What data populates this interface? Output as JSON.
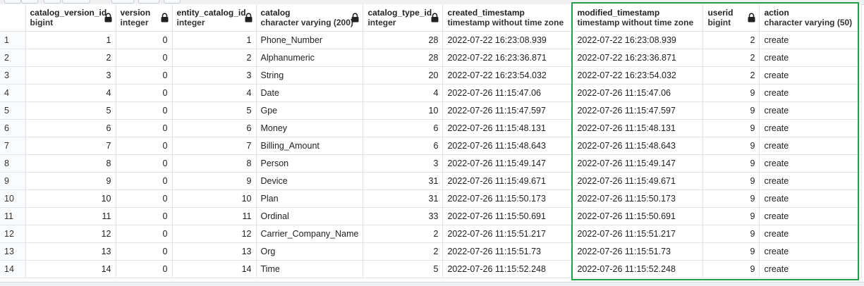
{
  "columns": [
    {
      "name": "catalog_version_id",
      "type": "bigint"
    },
    {
      "name": "version",
      "type": "integer"
    },
    {
      "name": "entity_catalog_id",
      "type": "integer"
    },
    {
      "name": "catalog",
      "type": "character varying (200)"
    },
    {
      "name": "catalog_type_id",
      "type": "integer"
    },
    {
      "name": "created_timestamp",
      "type": "timestamp without time zone"
    },
    {
      "name": "modified_timestamp",
      "type": "timestamp without time zone"
    },
    {
      "name": "userid",
      "type": "bigint"
    },
    {
      "name": "action",
      "type": "character varying (50)"
    }
  ],
  "rows": [
    {
      "rownum": "1",
      "cells": [
        "1",
        "0",
        "1",
        "Phone_Number",
        "28",
        "2022-07-22 16:23:08.939",
        "2022-07-22 16:23:08.939",
        "2",
        "create"
      ]
    },
    {
      "rownum": "2",
      "cells": [
        "2",
        "0",
        "2",
        "Alphanumeric",
        "28",
        "2022-07-22 16:23:36.871",
        "2022-07-22 16:23:36.871",
        "2",
        "create"
      ]
    },
    {
      "rownum": "3",
      "cells": [
        "3",
        "0",
        "3",
        "String",
        "20",
        "2022-07-22 16:23:54.032",
        "2022-07-22 16:23:54.032",
        "2",
        "create"
      ]
    },
    {
      "rownum": "4",
      "cells": [
        "4",
        "0",
        "4",
        "Date",
        "4",
        "2022-07-26 11:15:47.06",
        "2022-07-26 11:15:47.06",
        "9",
        "create"
      ]
    },
    {
      "rownum": "5",
      "cells": [
        "5",
        "0",
        "5",
        "Gpe",
        "10",
        "2022-07-26 11:15:47.597",
        "2022-07-26 11:15:47.597",
        "9",
        "create"
      ]
    },
    {
      "rownum": "6",
      "cells": [
        "6",
        "0",
        "6",
        "Money",
        "6",
        "2022-07-26 11:15:48.131",
        "2022-07-26 11:15:48.131",
        "9",
        "create"
      ]
    },
    {
      "rownum": "7",
      "cells": [
        "7",
        "0",
        "7",
        "Billing_Amount",
        "6",
        "2022-07-26 11:15:48.643",
        "2022-07-26 11:15:48.643",
        "9",
        "create"
      ]
    },
    {
      "rownum": "8",
      "cells": [
        "8",
        "0",
        "8",
        "Person",
        "3",
        "2022-07-26 11:15:49.147",
        "2022-07-26 11:15:49.147",
        "9",
        "create"
      ]
    },
    {
      "rownum": "9",
      "cells": [
        "9",
        "0",
        "9",
        "Device",
        "31",
        "2022-07-26 11:15:49.671",
        "2022-07-26 11:15:49.671",
        "9",
        "create"
      ]
    },
    {
      "rownum": "10",
      "cells": [
        "10",
        "0",
        "10",
        "Plan",
        "31",
        "2022-07-26 11:15:50.173",
        "2022-07-26 11:15:50.173",
        "9",
        "create"
      ]
    },
    {
      "rownum": "11",
      "cells": [
        "11",
        "0",
        "11",
        "Ordinal",
        "33",
        "2022-07-26 11:15:50.691",
        "2022-07-26 11:15:50.691",
        "9",
        "create"
      ]
    },
    {
      "rownum": "12",
      "cells": [
        "12",
        "0",
        "12",
        "Carrier_Company_Name",
        "2",
        "2022-07-26 11:15:51.217",
        "2022-07-26 11:15:51.217",
        "9",
        "create"
      ]
    },
    {
      "rownum": "13",
      "cells": [
        "13",
        "0",
        "13",
        "Org",
        "2",
        "2022-07-26 11:15:51.73",
        "2022-07-26 11:15:51.73",
        "9",
        "create"
      ]
    },
    {
      "rownum": "14",
      "cells": [
        "14",
        "0",
        "14",
        "Time",
        "5",
        "2022-07-26 11:15:52.248",
        "2022-07-26 11:15:52.248",
        "9",
        "create"
      ]
    }
  ],
  "colors": {
    "highlight_border": "#24a148",
    "grid_line": "#e3e5e8"
  }
}
